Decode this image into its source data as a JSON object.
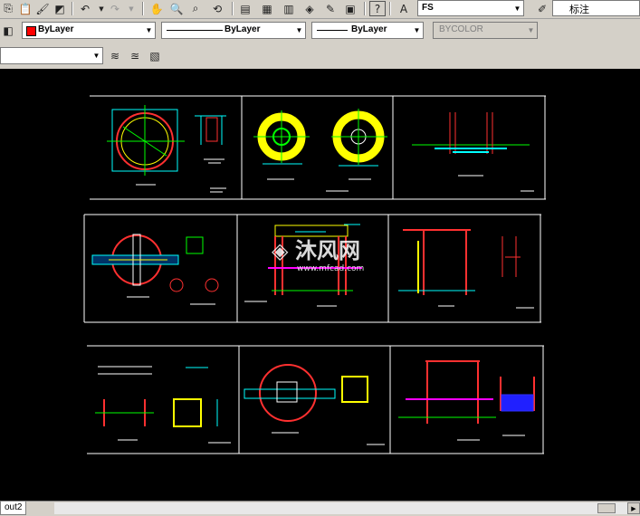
{
  "toolbar_top": {
    "text_style_value": "FS",
    "dim_style_label": "标注"
  },
  "properties": {
    "color_value": "ByLayer",
    "linetype_value": "ByLayer",
    "lineweight_value": "ByLayer",
    "plotstyle_value": "BYCOLOR",
    "layer_value": ""
  },
  "drawing": {
    "watermark_text": "沐风网",
    "watermark_url": "www.mfcad.com"
  },
  "status": {
    "layout_tab_label": "out2"
  },
  "colors": {
    "background": "#000000",
    "frame": "#ffffff",
    "green": "#00ff00",
    "red": "#ff2020",
    "yellow": "#ffff00",
    "cyan": "#00ffff",
    "blue": "#3030ff",
    "magenta": "#ff00ff"
  }
}
